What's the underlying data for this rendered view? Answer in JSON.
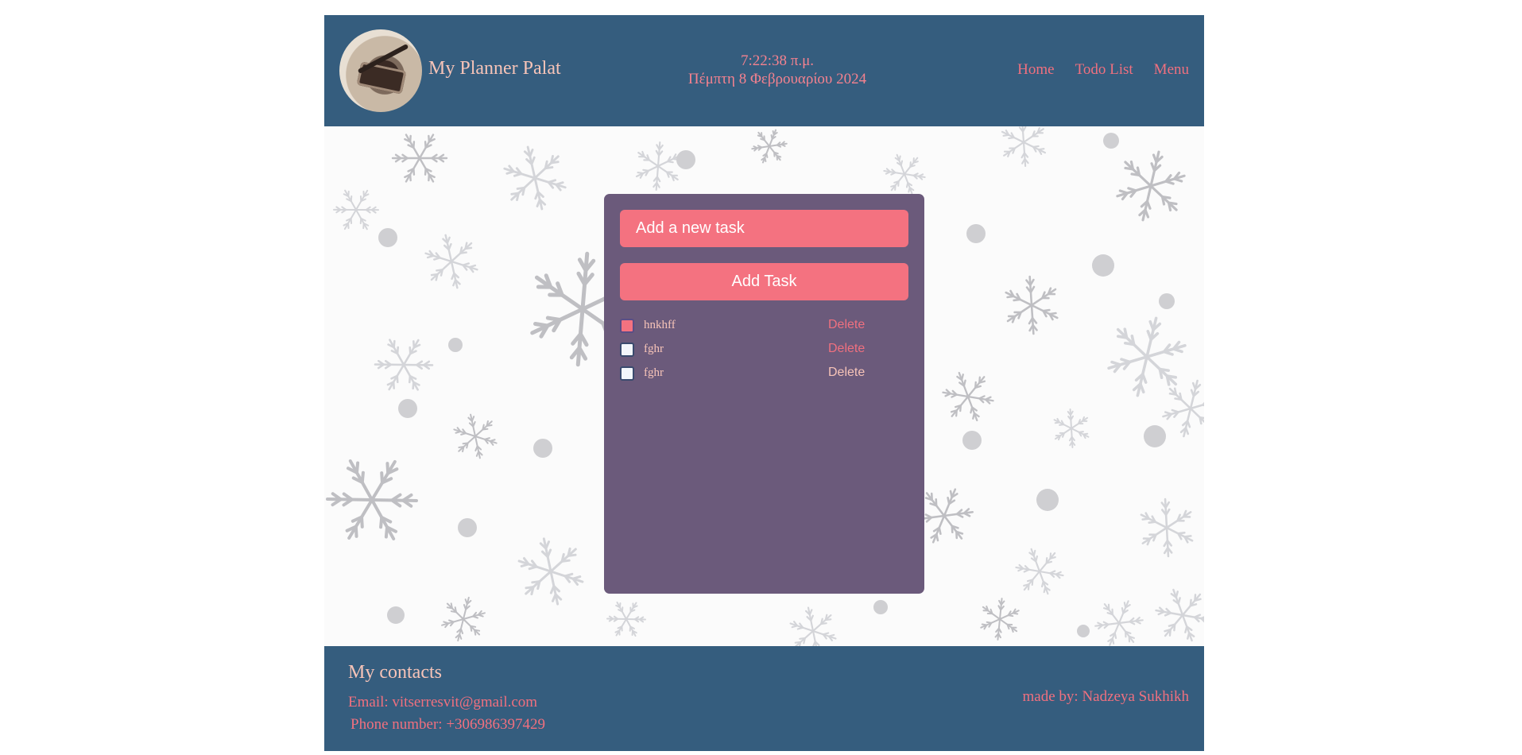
{
  "header": {
    "site_title": "My Planner Palat",
    "time": "7:22:38 π.μ.",
    "date": "Πέμπτη 8 Φεβρουαρίου 2024",
    "nav": [
      {
        "label": "Home"
      },
      {
        "label": "Todo List"
      },
      {
        "label": "Menu"
      }
    ]
  },
  "todo": {
    "input_placeholder": "Add a new task",
    "add_button_label": "Add Task",
    "tasks": [
      {
        "text": "hnkhff",
        "completed": true,
        "delete_label": "Delete",
        "delete_color": "#f0707f"
      },
      {
        "text": "fghr",
        "completed": false,
        "delete_label": "Delete",
        "delete_color": "#f0707f"
      },
      {
        "text": "fghr",
        "completed": false,
        "delete_label": "Delete",
        "delete_color": "#f7c4b8"
      }
    ]
  },
  "footer": {
    "contacts_title": "My contacts",
    "email": "Email: vitserresvit@gmail.com",
    "phone": "Phone number: +306986397429",
    "credits": "made by: Nadzeya Sukhikh"
  },
  "colors": {
    "header_bg": "#355d7e",
    "card_bg": "#6b5a7b",
    "accent": "#f47280",
    "text_peach": "#f7c4b8",
    "link_pink": "#f0707f"
  }
}
